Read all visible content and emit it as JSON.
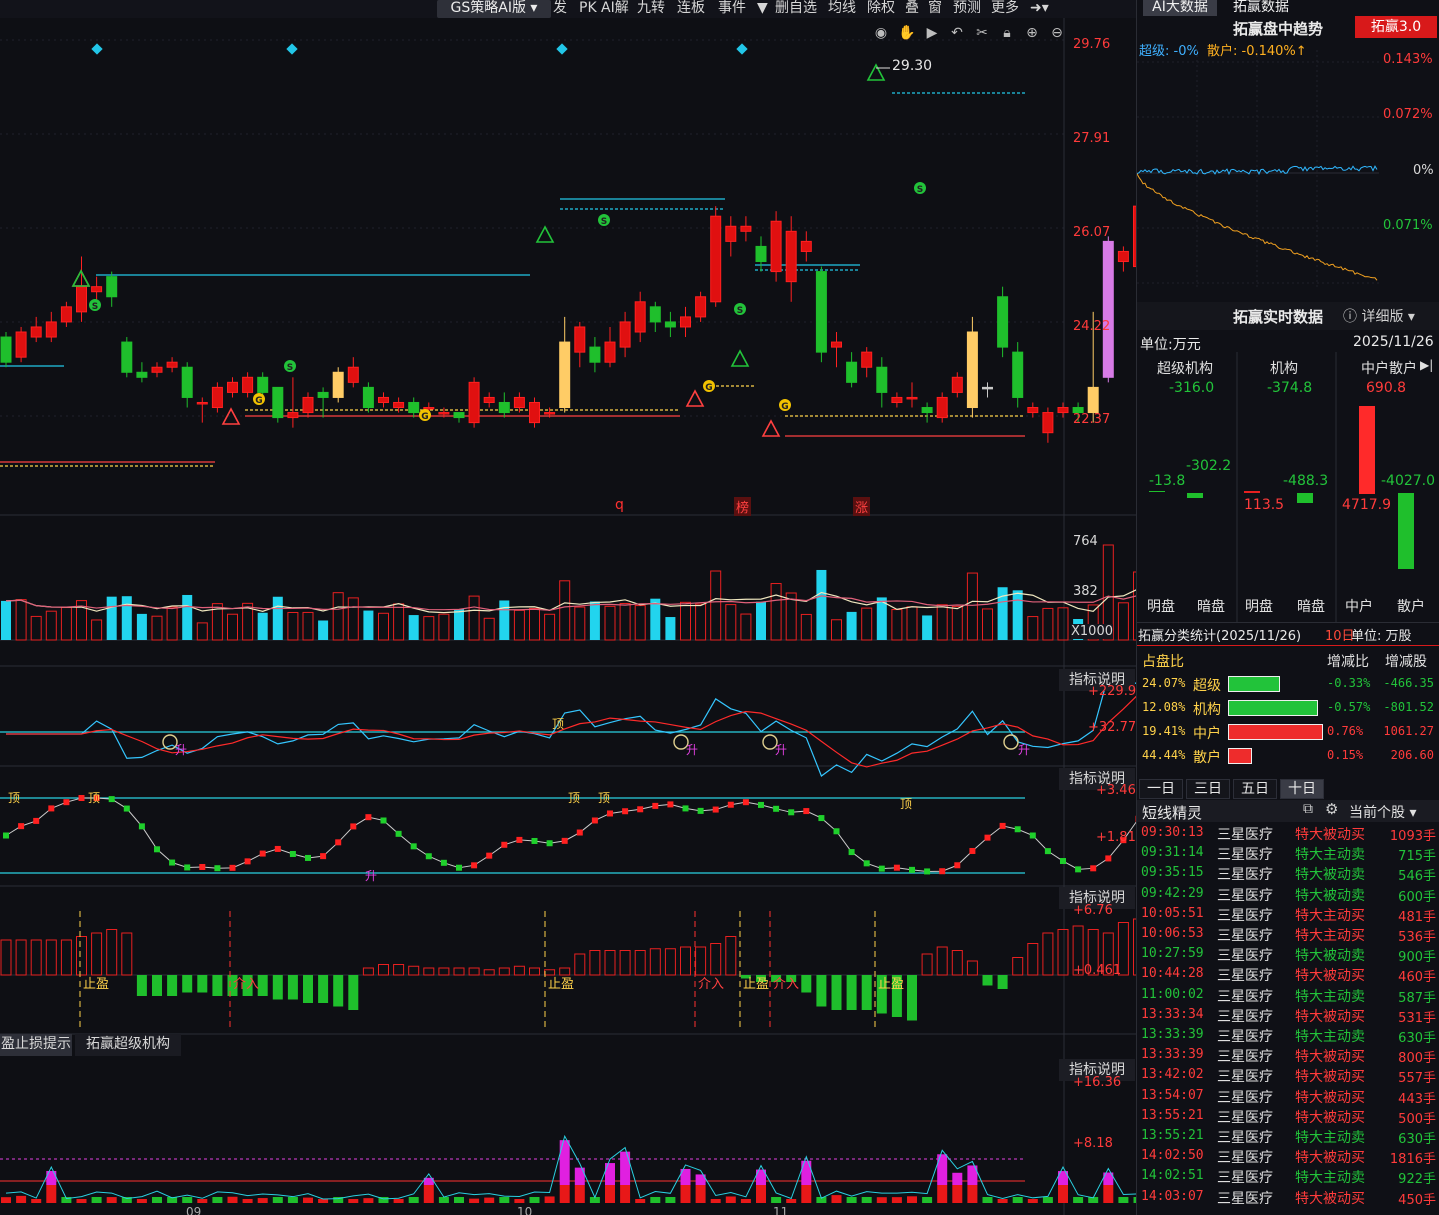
{
  "toolbar": {
    "strategy": "GS策略AI版",
    "items": [
      "发",
      "PK",
      "AI解",
      "九转",
      "连板",
      "事件",
      "▼",
      "删自选",
      "均线",
      "除权",
      "叠",
      "窗",
      "预测",
      "更多"
    ]
  },
  "main": {
    "price_axis": [
      "29.76",
      "27.91",
      "26.07",
      "24.22",
      "22.37"
    ],
    "high_label": "29.30",
    "event_markers": [
      "q",
      "榜",
      "涨"
    ],
    "bottom_date_labels": [
      "09",
      "10",
      "11"
    ]
  },
  "volume": {
    "axis": [
      "764",
      "382",
      "X1000"
    ]
  },
  "indicators": {
    "explain_label": "指标说明",
    "ind1_axis": [
      "+229.9",
      "+32.77"
    ],
    "ind1_marks": [
      "升",
      "顶",
      "升",
      "升",
      "升"
    ],
    "ind2_axis": [
      "+3.46",
      "+1.81"
    ],
    "ind2_marks": [
      "顶",
      "顶",
      "升",
      "顶",
      "顶"
    ],
    "ind3_axis": [
      "+6.76",
      "+0.461"
    ],
    "ind3_marks": [
      "止盈",
      "介入",
      "止盈",
      "介入",
      "止盈",
      "介入",
      "止盈"
    ],
    "ind4_axis": [
      "+16.36",
      "+8.18"
    ]
  },
  "bottom_tabs": [
    "盈止损提示",
    "拓赢超级机构"
  ],
  "right": {
    "tabs": [
      "AI大数据",
      "拓赢数据"
    ],
    "trend_title": "拓赢盘中趋势",
    "trend_badge": "拓赢3.0",
    "trend_super": "超级: -0%",
    "trend_retail": "散户: -0.140%↑",
    "trend_axis": [
      "0.143%",
      "0.072%",
      "0%",
      "0.071%"
    ],
    "realtime_title": "拓赢实时数据",
    "detail": "详细版",
    "unit": "单位:万元",
    "date": "2025/11/26",
    "groups": [
      {
        "name": "超级机构",
        "total": "-316.0",
        "left": "-13.8",
        "right": "-302.2",
        "l1": "明盘",
        "l2": "暗盘"
      },
      {
        "name": "机构",
        "total": "-374.8",
        "left": "113.5",
        "right": "-488.3",
        "l1": "明盘",
        "l2": "暗盘"
      },
      {
        "name": "中户散户",
        "total": "690.8",
        "left": "4717.9",
        "right": "-4027.0",
        "l1": "中户",
        "l2": "散户"
      }
    ],
    "stats_title": "拓赢分类统计(2025/11/26)",
    "stats_period": "10日",
    "stats_unit": "单位: 万股",
    "stats_headers": [
      "占盘比",
      "增减比",
      "增减股"
    ],
    "stats_rows": [
      {
        "pct": "24.07%",
        "name": "超级",
        "ratio": "-0.33%",
        "shares": "-466.35",
        "color": "#22c33a",
        "bar": 0.55
      },
      {
        "pct": "12.08%",
        "name": "机构",
        "ratio": "-0.57%",
        "shares": "-801.52",
        "color": "#22c33a",
        "bar": 0.95
      },
      {
        "pct": "19.41%",
        "name": "中户",
        "ratio": "0.76%",
        "shares": "1061.27",
        "color": "#ee2c2c",
        "bar": 1.0
      },
      {
        "pct": "44.44%",
        "name": "散户",
        "ratio": "0.15%",
        "shares": "206.60",
        "color": "#ee2c2c",
        "bar": 0.25
      }
    ],
    "period_tabs": [
      "一日",
      "三日",
      "五日",
      "十日"
    ],
    "sprite_title": "短线精灵",
    "sprite_scope": "当前个股",
    "trades": [
      {
        "t": "09:30:13",
        "name": "三星医疗",
        "type": "特大被动买",
        "qty": "1093手",
        "c": "r"
      },
      {
        "t": "09:31:14",
        "name": "三星医疗",
        "type": "特大主动卖",
        "qty": "715手",
        "c": "g"
      },
      {
        "t": "09:35:15",
        "name": "三星医疗",
        "type": "特大被动卖",
        "qty": "546手",
        "c": "g"
      },
      {
        "t": "09:42:29",
        "name": "三星医疗",
        "type": "特大被动卖",
        "qty": "600手",
        "c": "g"
      },
      {
        "t": "10:05:51",
        "name": "三星医疗",
        "type": "特大主动买",
        "qty": "481手",
        "c": "r"
      },
      {
        "t": "10:06:53",
        "name": "三星医疗",
        "type": "特大主动买",
        "qty": "536手",
        "c": "r"
      },
      {
        "t": "10:27:59",
        "name": "三星医疗",
        "type": "特大被动卖",
        "qty": "900手",
        "c": "g"
      },
      {
        "t": "10:44:28",
        "name": "三星医疗",
        "type": "特大被动买",
        "qty": "460手",
        "c": "r"
      },
      {
        "t": "11:00:02",
        "name": "三星医疗",
        "type": "特大主动卖",
        "qty": "587手",
        "c": "g"
      },
      {
        "t": "13:33:34",
        "name": "三星医疗",
        "type": "特大被动买",
        "qty": "531手",
        "c": "r"
      },
      {
        "t": "13:33:39",
        "name": "三星医疗",
        "type": "特大主动卖",
        "qty": "630手",
        "c": "g"
      },
      {
        "t": "13:33:39",
        "name": "三星医疗",
        "type": "特大被动买",
        "qty": "800手",
        "c": "r"
      },
      {
        "t": "13:42:02",
        "name": "三星医疗",
        "type": "特大被动买",
        "qty": "557手",
        "c": "r"
      },
      {
        "t": "13:54:07",
        "name": "三星医疗",
        "type": "特大被动买",
        "qty": "443手",
        "c": "r"
      },
      {
        "t": "13:55:21",
        "name": "三星医疗",
        "type": "特大被动买",
        "qty": "500手",
        "c": "r"
      },
      {
        "t": "13:55:21",
        "name": "三星医疗",
        "type": "特大主动卖",
        "qty": "630手",
        "c": "g"
      },
      {
        "t": "14:02:50",
        "name": "三星医疗",
        "type": "特大被动买",
        "qty": "1816手",
        "c": "r"
      },
      {
        "t": "14:02:51",
        "name": "三星医疗",
        "type": "特大主动卖",
        "qty": "922手",
        "c": "g"
      },
      {
        "t": "14:03:07",
        "name": "三星医疗",
        "type": "特大被动买",
        "qty": "450手",
        "c": "r"
      }
    ]
  },
  "chart_data": {
    "type": "candlestick",
    "y_range": [
      21.5,
      30.2
    ],
    "candles": [
      [
        24.3,
        23.8,
        24.4,
        23.7
      ],
      [
        23.9,
        24.4,
        24.5,
        23.8
      ],
      [
        24.3,
        24.5,
        24.7,
        24.2
      ],
      [
        24.3,
        24.6,
        24.8,
        24.2
      ],
      [
        24.6,
        24.9,
        25.0,
        24.5
      ],
      [
        24.8,
        25.3,
        25.9,
        24.6
      ],
      [
        25.2,
        25.3,
        25.5,
        25.0
      ],
      [
        25.5,
        25.1,
        25.6,
        24.9
      ],
      [
        24.2,
        23.6,
        24.3,
        23.5
      ],
      [
        23.6,
        23.5,
        23.8,
        23.4
      ],
      [
        23.6,
        23.7,
        23.8,
        23.5
      ],
      [
        23.7,
        23.8,
        23.9,
        23.6
      ],
      [
        23.7,
        23.1,
        23.8,
        22.9
      ],
      [
        23.0,
        23.0,
        23.1,
        22.6
      ],
      [
        22.9,
        23.3,
        23.4,
        22.8
      ],
      [
        23.2,
        23.4,
        23.5,
        23.1
      ],
      [
        23.2,
        23.5,
        23.6,
        23.1
      ],
      [
        23.5,
        23.2,
        23.6,
        23.1
      ],
      [
        23.3,
        22.7,
        23.3,
        22.6
      ],
      [
        22.7,
        22.8,
        23.5,
        22.5
      ],
      [
        22.8,
        23.1,
        23.2,
        22.7
      ],
      [
        23.2,
        23.1,
        23.3,
        22.7
      ],
      [
        23.1,
        23.6,
        23.7,
        23.0
      ],
      [
        23.4,
        23.7,
        23.9,
        23.3
      ],
      [
        23.3,
        22.9,
        23.4,
        22.8
      ],
      [
        23.0,
        23.1,
        23.2,
        22.9
      ],
      [
        22.9,
        23.0,
        23.1,
        22.8
      ],
      [
        23.0,
        22.8,
        23.1,
        22.7
      ],
      [
        22.9,
        22.9,
        23.0,
        22.8
      ],
      [
        22.8,
        22.8,
        22.9,
        22.7
      ],
      [
        22.8,
        22.7,
        22.8,
        22.6
      ],
      [
        22.6,
        23.4,
        23.5,
        22.5
      ],
      [
        23.0,
        23.1,
        23.2,
        22.9
      ],
      [
        23.0,
        22.8,
        23.2,
        22.7
      ],
      [
        22.9,
        23.1,
        23.2,
        22.8
      ],
      [
        22.6,
        23.0,
        23.1,
        22.5
      ],
      [
        22.8,
        22.8,
        22.9,
        22.7
      ],
      [
        22.9,
        24.2,
        24.7,
        22.8
      ],
      [
        24.0,
        24.5,
        24.6,
        23.7
      ],
      [
        24.1,
        23.8,
        24.3,
        23.6
      ],
      [
        23.8,
        24.2,
        24.5,
        23.7
      ],
      [
        24.1,
        24.6,
        24.8,
        23.9
      ],
      [
        24.4,
        25.0,
        25.2,
        24.2
      ],
      [
        24.9,
        24.6,
        25.0,
        24.4
      ],
      [
        24.6,
        24.5,
        24.8,
        24.3
      ],
      [
        24.5,
        24.7,
        24.9,
        24.3
      ],
      [
        24.7,
        25.1,
        25.2,
        24.6
      ],
      [
        25.0,
        26.7,
        26.9,
        24.9
      ],
      [
        26.2,
        26.5,
        26.7,
        25.9
      ],
      [
        26.4,
        26.5,
        26.7,
        26.2
      ],
      [
        26.1,
        25.8,
        26.3,
        25.6
      ],
      [
        25.6,
        26.6,
        26.8,
        25.4
      ],
      [
        25.4,
        26.4,
        26.7,
        25.0
      ],
      [
        26.0,
        26.2,
        26.4,
        25.8
      ],
      [
        25.6,
        24.0,
        25.7,
        23.8
      ],
      [
        24.1,
        24.2,
        24.4,
        23.7
      ],
      [
        23.8,
        23.4,
        24.0,
        23.3
      ],
      [
        23.7,
        24.0,
        24.1,
        23.5
      ],
      [
        23.7,
        23.2,
        23.9,
        22.9
      ],
      [
        23.0,
        23.1,
        23.2,
        22.9
      ],
      [
        23.1,
        23.1,
        23.4,
        22.9
      ],
      [
        22.9,
        22.8,
        23.0,
        22.6
      ],
      [
        22.7,
        23.1,
        23.2,
        22.6
      ],
      [
        23.2,
        23.5,
        23.6,
        23.1
      ],
      [
        22.9,
        24.4,
        24.7,
        22.7
      ],
      [
        23.3,
        23.3,
        23.4,
        23.1
      ],
      [
        25.1,
        24.1,
        25.3,
        23.9
      ],
      [
        24.0,
        23.1,
        24.2,
        22.9
      ],
      [
        22.8,
        22.9,
        23.0,
        22.7
      ],
      [
        22.4,
        22.8,
        22.9,
        22.2
      ],
      [
        22.8,
        22.9,
        23.0,
        22.7
      ],
      [
        22.9,
        22.8,
        23.0,
        22.6
      ],
      [
        22.8,
        23.3,
        24.8,
        22.6
      ],
      [
        23.5,
        26.2,
        26.3,
        23.4
      ],
      [
        25.8,
        26.0,
        26.1,
        25.6
      ],
      [
        25.7,
        26.9,
        27.3,
        25.6
      ],
      [
        26.8,
        26.7,
        27.6,
        26.6
      ],
      [
        26.9,
        26.5,
        27.1,
        26.0
      ],
      [
        26.9,
        26.1,
        27.0,
        25.7
      ],
      [
        28.6,
        28.0,
        29.3,
        28.3
      ],
      [
        28.3,
        27.2,
        28.4,
        27.0
      ],
      [
        27.2,
        27.1,
        27.4,
        26.9
      ],
      [
        27.3,
        27.0,
        27.4,
        26.8
      ],
      [
        26.8,
        26.4,
        27.0,
        26.3
      ],
      [
        26.7,
        25.9,
        26.8,
        25.7
      ],
      [
        26.0,
        25.6,
        26.3,
        25.4
      ],
      [
        25.5,
        25.1,
        25.6,
        24.8
      ],
      [
        25.2,
        24.4,
        25.3,
        24.2
      ],
      [
        24.2,
        23.6,
        24.4,
        23.5
      ],
      [
        23.8,
        23.5,
        24.0,
        23.3
      ],
      [
        23.5,
        22.9,
        23.6,
        22.8
      ],
      [
        23.1,
        22.9,
        23.3,
        22.7
      ]
    ]
  }
}
